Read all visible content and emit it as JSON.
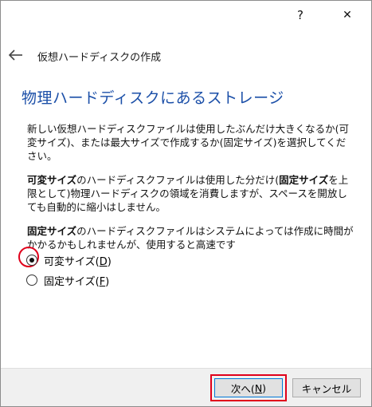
{
  "titlebar": {
    "help_label": "?",
    "close_label": "✕"
  },
  "nav": {
    "back_icon": "arrow-left-icon",
    "title": "仮想ハードディスクの作成"
  },
  "heading": "物理ハードディスクにあるストレージ",
  "paragraphs": {
    "p1": "新しい仮想ハードディスクファイルは使用したぶんだけ大きくなるか(可変サイズ)、または最大サイズで作成するか(固定サイズ)を選択してください。",
    "p2_bold1": "可変サイズ",
    "p2_text1": "のハードディスクファイルは使用した分だけ(",
    "p2_bold2": "固定サイズ",
    "p2_text2": "を上限として)物理ハードディスクの領域を消費しますが、スペースを開放しても自動的に縮小はしません。",
    "p3_bold": "固定サイズ",
    "p3_text": "のハードディスクファイルはシステムによっては作成に時間がかかるかもしれませんが、使用すると高速です"
  },
  "options": {
    "variable": {
      "label": "可変サイズ(",
      "accel": "D",
      "suffix": ")",
      "selected": true
    },
    "fixed": {
      "label": "固定サイズ(",
      "accel": "F",
      "suffix": ")",
      "selected": false
    }
  },
  "buttons": {
    "next_label": "次へ(",
    "next_accel": "N",
    "next_suffix": ")",
    "cancel_label": "キャンセル"
  },
  "colors": {
    "heading": "#1b4fa8",
    "highlight": "#e0001b",
    "default_button_border": "#0078d7",
    "footer_bg": "#f0f0f0"
  }
}
